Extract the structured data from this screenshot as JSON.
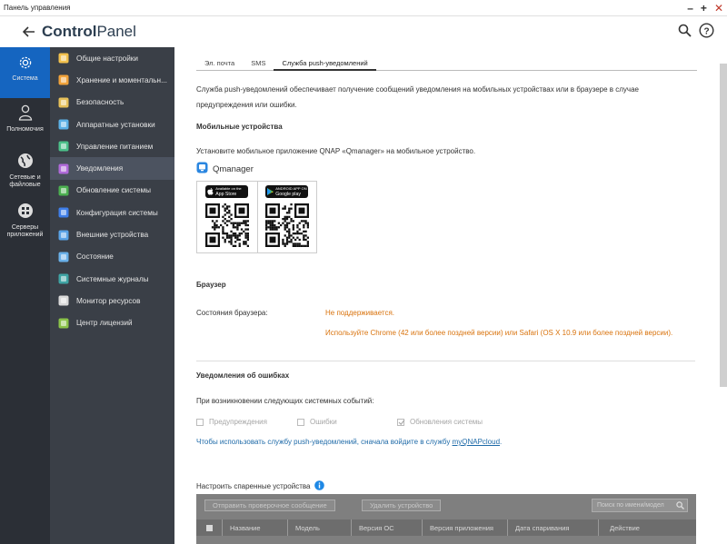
{
  "window": {
    "title": "Панель управления"
  },
  "header": {
    "title_bold": "Control",
    "title_light": "Panel"
  },
  "rail": [
    {
      "label": "Система",
      "icon": "gear-icon"
    },
    {
      "label": "Полномочия",
      "icon": "user-icon"
    },
    {
      "label": "Сетевые и файловые",
      "icon": "globe-icon"
    },
    {
      "label": "Серверы приложений",
      "icon": "apps-icon"
    }
  ],
  "menu": [
    {
      "label": "Общие настройки",
      "icon": "settings-icon",
      "color": "#f2c14e"
    },
    {
      "label": "Хранение и моментальн...",
      "icon": "storage-icon",
      "color": "#f0a23b"
    },
    {
      "label": "Безопасность",
      "icon": "security-icon",
      "color": "#e6c05a"
    },
    {
      "label": "Аппаратные установки",
      "icon": "hardware-icon",
      "color": "#5cb1e6"
    },
    {
      "label": "Управление питанием",
      "icon": "power-icon",
      "color": "#4cc08a"
    },
    {
      "label": "Уведомления",
      "icon": "notification-icon",
      "color": "#b06ad9"
    },
    {
      "label": "Обновление системы",
      "icon": "update-icon",
      "color": "#4caf50"
    },
    {
      "label": "Конфигурация системы",
      "icon": "config-icon",
      "color": "#3f7ee8"
    },
    {
      "label": "Внешние устройства",
      "icon": "external-icon",
      "color": "#5aa3e6"
    },
    {
      "label": "Состояние",
      "icon": "status-icon",
      "color": "#6ab0e8"
    },
    {
      "label": "Системные журналы",
      "icon": "logs-icon",
      "color": "#3fa4a4"
    },
    {
      "label": "Монитор ресурсов",
      "icon": "monitor-icon",
      "color": "#d9d9d9"
    },
    {
      "label": "Центр лицензий",
      "icon": "license-icon",
      "color": "#8bc34a"
    }
  ],
  "tabs": [
    "Эл. почта",
    "SMS",
    "Служба push-уведомлений"
  ],
  "content": {
    "intro_line1": "Служба push-уведомлений обеспечивает получение сообщений уведомления на мобильных устройствах или в браузере в случае",
    "intro_line2": "предупреждения или ошибки.",
    "mobile_heading": "Мобильные устройства",
    "mobile_text": "Установите мобильное приложение QNAP «Qmanager» на мобильное устройство.",
    "app_name": "Qmanager",
    "appstore_small": "Available on the",
    "appstore_big": "App Store",
    "gplay_small": "ANDROID APP ON",
    "gplay_big": "Google play",
    "browser_heading": "Браузер",
    "browser_state_label": "Состояния браузера:",
    "browser_state_value": "Не поддерживается.",
    "browser_hint": "Используйте Chrome (42 или более поздней версии) или Safari (OS X 10.9 или более поздней версии).",
    "errors_heading": "Уведомления об ошибках",
    "errors_text": "При возникновении следующих системных событий:",
    "cb_warnings": "Предупреждения",
    "cb_errors": "Ошибки",
    "cb_updates": "Обновления системы",
    "signin_text": "Чтобы использовать службу push-уведомлений, сначала войдите в службу ",
    "signin_link": "myQNAPcloud",
    "signin_dot": ".",
    "paired_label": "Настроить спаренные устройства"
  },
  "grid": {
    "btn_test": "Отправить проверочное сообщение",
    "btn_delete": "Удалить устройство",
    "search_placeholder": "Поиск по имени/модел",
    "columns": [
      "Название",
      "Модель",
      "Версия ОС",
      "Версия приложения",
      "Дата спаривания",
      "Действие"
    ]
  },
  "colors": {
    "accent": "#1565c0",
    "warning_text": "#d9730d",
    "link": "#1e6aa8"
  }
}
